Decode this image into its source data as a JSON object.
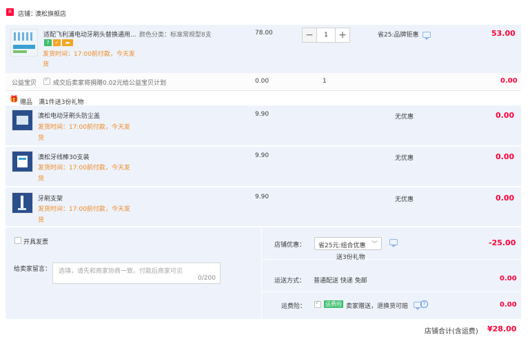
{
  "shop": {
    "badge_text": "天猫",
    "label": "店铺：",
    "name": "澳松旗舰店"
  },
  "main_item": {
    "title": "适配飞利浦电动牙刷头替换通用...",
    "spec": "颜色分类：标准常规型8支",
    "price": "78.00",
    "quantity": "1",
    "discount": "省25:品牌钜惠",
    "subtotal": "53.00",
    "ship_line1": "发货时间：17:00前付款，今天发",
    "ship_line2": "货"
  },
  "charity": {
    "label": "公益宝贝",
    "text": "成交后卖家将捐赠0.02元给公益宝贝计划",
    "price": "0.00",
    "quantity": "1",
    "subtotal": "0.00"
  },
  "gift": {
    "icon_label": "赠品",
    "text": "满1件送3份礼物"
  },
  "gift_items": [
    {
      "title": "澳松电动牙刷头防尘盖",
      "ship_line1": "发货时间：17:00前付款，今天发",
      "ship_line2": "货",
      "price": "9.90",
      "discount": "无优惠",
      "subtotal": "0.00"
    },
    {
      "title": "澳松牙线棒30支装",
      "ship_line1": "发货时间：17:00前付款，今天发",
      "ship_line2": "货",
      "price": "9.90",
      "discount": "无优惠",
      "subtotal": "0.00"
    },
    {
      "title": "牙刷支架",
      "ship_line1": "发货时间：17:00前付款，今天发",
      "ship_line2": "货",
      "price": "9.90",
      "discount": "无优惠",
      "subtotal": "0.00"
    }
  ],
  "invoice": {
    "label": "开具发票"
  },
  "message": {
    "label": "给卖家留言：",
    "placeholder": "选填，请先和商家协商一致，付款后商家可见",
    "counter": "0/200"
  },
  "shop_discount": {
    "label": "店铺优惠：",
    "selected": "省25元:组合优惠",
    "gift_note": "送3份礼物",
    "amount": "-25.00"
  },
  "shipping": {
    "label": "运送方式：",
    "method": "普通配送 快递 免邮",
    "amount": "0.00"
  },
  "insurance": {
    "label": "运费险：",
    "badge": "运费险",
    "text": "卖家赠送，退换货可赔",
    "help": "?",
    "amount": "0.00"
  },
  "total": {
    "label": "店铺合计(含运费)",
    "amount": "¥28.00"
  },
  "colors": {
    "accent_red": "#ff0036",
    "ship_orange": "#f08a24",
    "panel_blue": "#eef3fb",
    "insurance_green": "#3dbf6c"
  }
}
